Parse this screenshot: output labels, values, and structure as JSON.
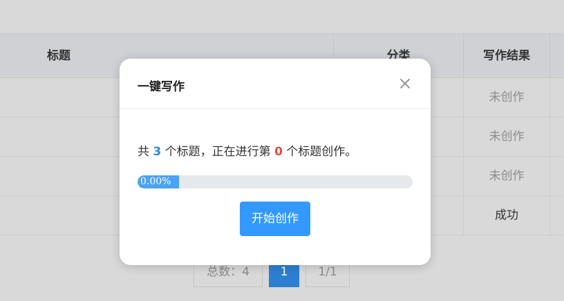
{
  "table": {
    "headers": {
      "title": "标题",
      "category": "分类",
      "result": "写作结果"
    },
    "rows": [
      {
        "result": "未创作"
      },
      {
        "result": "未创作"
      },
      {
        "result": "未创作"
      },
      {
        "result": "成功"
      }
    ]
  },
  "pagination": {
    "total": "总数：4",
    "current": "1",
    "fraction": "1/1"
  },
  "modal": {
    "title": "一键写作",
    "status": {
      "prefix": "共 ",
      "total_count": "3",
      "middle": " 个标题，正在进行第 ",
      "current_index": "0",
      "suffix": " 个标题创作。"
    },
    "progress": {
      "value": 0,
      "label": "0.00%"
    },
    "start_button": "开始创作"
  },
  "colors": {
    "accent": "#3399ff",
    "count_blue": "#2d8ae0",
    "index_red": "#e64b3c",
    "progress_fill": "#4aa3f5",
    "pager_active": "#2d7fd1"
  },
  "icons": {
    "close": "close-icon"
  }
}
